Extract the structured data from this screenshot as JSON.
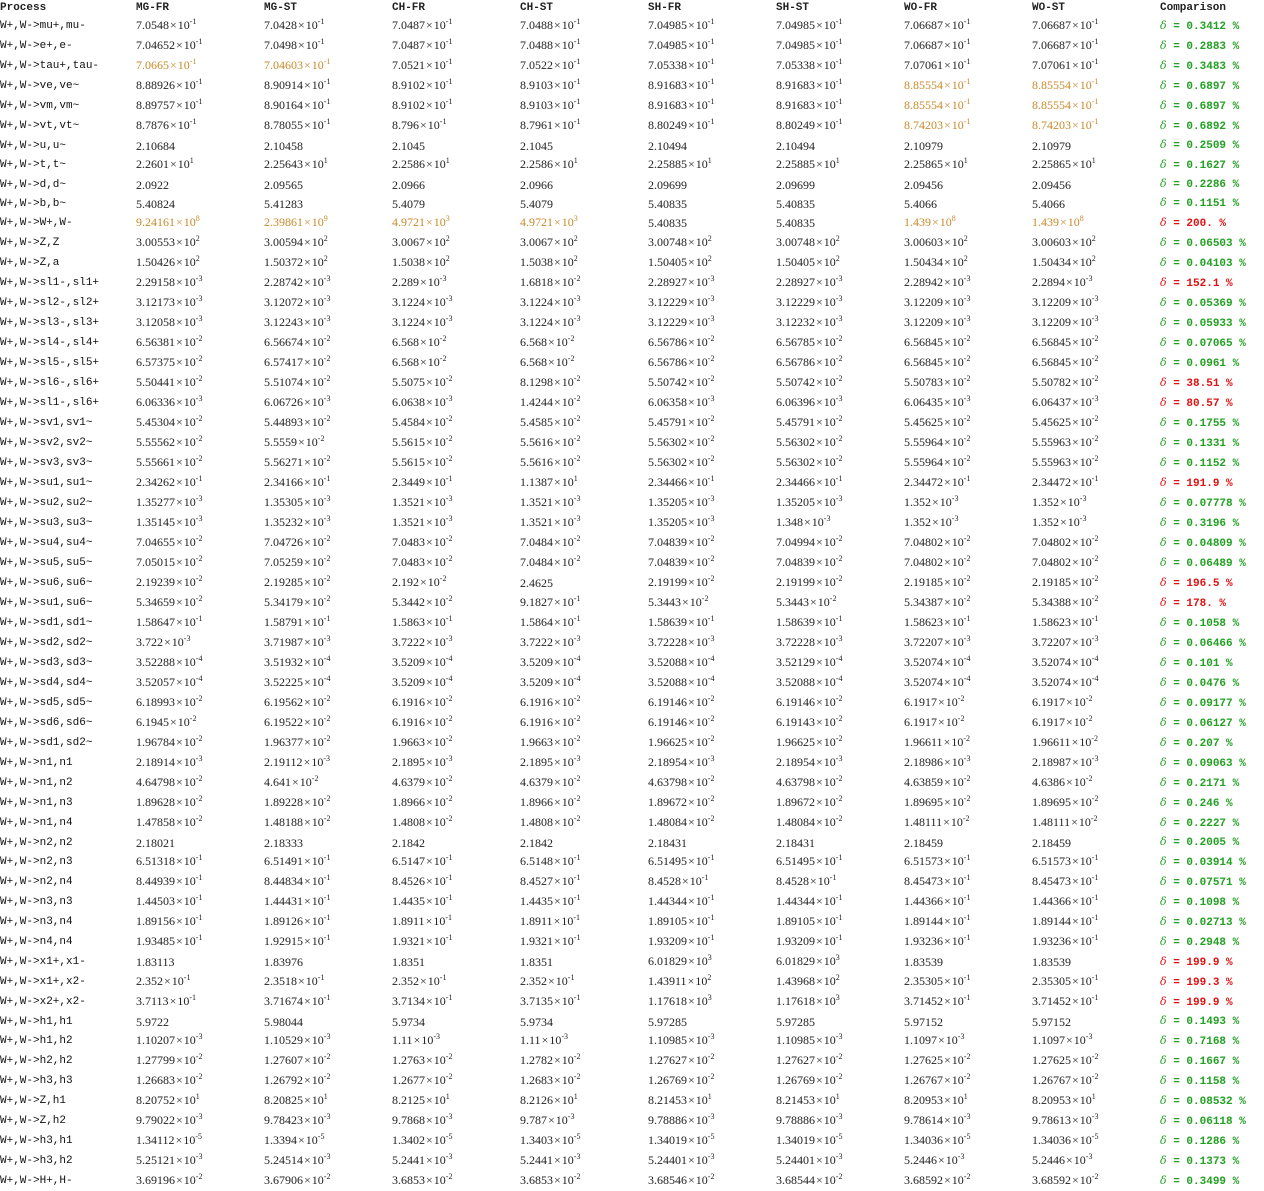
{
  "columns": [
    "Process",
    "MG-FR",
    "MG-ST",
    "CH-FR",
    "CH-ST",
    "SH-FR",
    "SH-ST",
    "WO-FR",
    "WO-ST",
    "Comparison"
  ],
  "colors": {
    "highlight": "#c88a2a",
    "good": "#22a022",
    "bad": "#dd1111"
  },
  "rows": [
    {
      "p": "W+,W->mu+,mu-",
      "v": [
        "7.0548|-1",
        "7.0428|-1",
        "7.0487|-1",
        "7.0488|-1",
        "7.04985|-1",
        "7.04985|-1",
        "7.06687|-1",
        "7.06687|-1"
      ],
      "hl": [],
      "c": "δ = 0.3412 %",
      "s": "good"
    },
    {
      "p": "W+,W->e+,e-",
      "v": [
        "7.04652|-1",
        "7.0498|-1",
        "7.0487|-1",
        "7.0488|-1",
        "7.04985|-1",
        "7.04985|-1",
        "7.06687|-1",
        "7.06687|-1"
      ],
      "hl": [],
      "c": "δ = 0.2883 %",
      "s": "good"
    },
    {
      "p": "W+,W->tau+,tau-",
      "v": [
        "7.0665|-1",
        "7.04603|-1",
        "7.0521|-1",
        "7.0522|-1",
        "7.05338|-1",
        "7.05338|-1",
        "7.07061|-1",
        "7.07061|-1"
      ],
      "hl": [
        0,
        1
      ],
      "c": "δ = 0.3483 %",
      "s": "good"
    },
    {
      "p": "W+,W->ve,ve~",
      "v": [
        "8.88926|-1",
        "8.90914|-1",
        "8.9102|-1",
        "8.9103|-1",
        "8.91683|-1",
        "8.91683|-1",
        "8.85554|-1",
        "8.85554|-1"
      ],
      "hl": [
        6,
        7
      ],
      "c": "δ = 0.6897 %",
      "s": "good"
    },
    {
      "p": "W+,W->vm,vm~",
      "v": [
        "8.89757|-1",
        "8.90164|-1",
        "8.9102|-1",
        "8.9103|-1",
        "8.91683|-1",
        "8.91683|-1",
        "8.85554|-1",
        "8.85554|-1"
      ],
      "hl": [
        6,
        7
      ],
      "c": "δ = 0.6897 %",
      "s": "good"
    },
    {
      "p": "W+,W->vt,vt~",
      "v": [
        "8.7876|-1",
        "8.78055|-1",
        "8.796|-1",
        "8.7961|-1",
        "8.80249|-1",
        "8.80249|-1",
        "8.74203|-1",
        "8.74203|-1"
      ],
      "hl": [
        6,
        7
      ],
      "c": "δ = 0.6892 %",
      "s": "good"
    },
    {
      "p": "W+,W->u,u~",
      "v": [
        "2.10684",
        "2.10458",
        "2.1045",
        "2.1045",
        "2.10494",
        "2.10494",
        "2.10979",
        "2.10979"
      ],
      "hl": [],
      "c": "δ = 0.2509 %",
      "s": "good"
    },
    {
      "p": "W+,W->t,t~",
      "v": [
        "2.2601|1",
        "2.25643|1",
        "2.2586|1",
        "2.2586|1",
        "2.25885|1",
        "2.25885|1",
        "2.25865|1",
        "2.25865|1"
      ],
      "hl": [],
      "c": "δ = 0.1627 %",
      "s": "good"
    },
    {
      "p": "W+,W->d,d~",
      "v": [
        "2.0922",
        "2.09565",
        "2.0966",
        "2.0966",
        "2.09699",
        "2.09699",
        "2.09456",
        "2.09456"
      ],
      "hl": [],
      "c": "δ = 0.2286 %",
      "s": "good"
    },
    {
      "p": "W+,W->b,b~",
      "v": [
        "5.40824",
        "5.41283",
        "5.4079",
        "5.4079",
        "5.40835",
        "5.40835",
        "5.4066",
        "5.4066"
      ],
      "hl": [],
      "c": "δ = 0.1151 %",
      "s": "good"
    },
    {
      "p": "W+,W->W+,W-",
      "v": [
        "9.24161|8",
        "2.39861|9",
        "4.9721|3",
        "4.9721|3",
        "5.40835",
        "5.40835",
        "1.439|8",
        "1.439|8"
      ],
      "hl": [
        0,
        1,
        2,
        3,
        6,
        7
      ],
      "c": "δ = 200. %",
      "s": "bad"
    },
    {
      "p": "W+,W->Z,Z",
      "v": [
        "3.00553|2",
        "3.00594|2",
        "3.0067|2",
        "3.0067|2",
        "3.00748|2",
        "3.00748|2",
        "3.00603|2",
        "3.00603|2"
      ],
      "hl": [],
      "c": "δ = 0.06503 %",
      "s": "good"
    },
    {
      "p": "W+,W->Z,a",
      "v": [
        "1.50426|2",
        "1.50372|2",
        "1.5038|2",
        "1.5038|2",
        "1.50405|2",
        "1.50405|2",
        "1.50434|2",
        "1.50434|2"
      ],
      "hl": [],
      "c": "δ = 0.04103 %",
      "s": "good"
    },
    {
      "p": "W+,W->sl1-,sl1+",
      "v": [
        "2.29158|-3",
        "2.28742|-3",
        "2.289|-3",
        "1.6818|-2",
        "2.28927|-3",
        "2.28927|-3",
        "2.28942|-3",
        "2.2894|-3"
      ],
      "hl": [],
      "c": "δ = 152.1 %",
      "s": "bad"
    },
    {
      "p": "W+,W->sl2-,sl2+",
      "v": [
        "3.12173|-3",
        "3.12072|-3",
        "3.1224|-3",
        "3.1224|-3",
        "3.12229|-3",
        "3.12229|-3",
        "3.12209|-3",
        "3.12209|-3"
      ],
      "hl": [],
      "c": "δ = 0.05369 %",
      "s": "good"
    },
    {
      "p": "W+,W->sl3-,sl3+",
      "v": [
        "3.12058|-3",
        "3.12243|-3",
        "3.1224|-3",
        "3.1224|-3",
        "3.12229|-3",
        "3.12232|-3",
        "3.12209|-3",
        "3.12209|-3"
      ],
      "hl": [],
      "c": "δ = 0.05933 %",
      "s": "good"
    },
    {
      "p": "W+,W->sl4-,sl4+",
      "v": [
        "6.56381|-2",
        "6.56674|-2",
        "6.568|-2",
        "6.568|-2",
        "6.56786|-2",
        "6.56785|-2",
        "6.56845|-2",
        "6.56845|-2"
      ],
      "hl": [],
      "c": "δ = 0.07065 %",
      "s": "good"
    },
    {
      "p": "W+,W->sl5-,sl5+",
      "v": [
        "6.57375|-2",
        "6.57417|-2",
        "6.568|-2",
        "6.568|-2",
        "6.56786|-2",
        "6.56786|-2",
        "6.56845|-2",
        "6.56845|-2"
      ],
      "hl": [],
      "c": "δ = 0.0961 %",
      "s": "good"
    },
    {
      "p": "W+,W->sl6-,sl6+",
      "v": [
        "5.50441|-2",
        "5.51074|-2",
        "5.5075|-2",
        "8.1298|-2",
        "5.50742|-2",
        "5.50742|-2",
        "5.50783|-2",
        "5.50782|-2"
      ],
      "hl": [],
      "c": "δ = 38.51 %",
      "s": "bad"
    },
    {
      "p": "W+,W->sl1-,sl6+",
      "v": [
        "6.06336|-3",
        "6.06726|-3",
        "6.0638|-3",
        "1.4244|-2",
        "6.06358|-3",
        "6.06396|-3",
        "6.06435|-3",
        "6.06437|-3"
      ],
      "hl": [],
      "c": "δ = 80.57 %",
      "s": "bad"
    },
    {
      "p": "W+,W->sv1,sv1~",
      "v": [
        "5.45304|-2",
        "5.44893|-2",
        "5.4584|-2",
        "5.4585|-2",
        "5.45791|-2",
        "5.45791|-2",
        "5.45625|-2",
        "5.45625|-2"
      ],
      "hl": [],
      "c": "δ = 0.1755 %",
      "s": "good"
    },
    {
      "p": "W+,W->sv2,sv2~",
      "v": [
        "5.55562|-2",
        "5.5559|-2",
        "5.5615|-2",
        "5.5616|-2",
        "5.56302|-2",
        "5.56302|-2",
        "5.55964|-2",
        "5.55963|-2"
      ],
      "hl": [],
      "c": "δ = 0.1331 %",
      "s": "good"
    },
    {
      "p": "W+,W->sv3,sv3~",
      "v": [
        "5.55661|-2",
        "5.56271|-2",
        "5.5615|-2",
        "5.5616|-2",
        "5.56302|-2",
        "5.56302|-2",
        "5.55964|-2",
        "5.55963|-2"
      ],
      "hl": [],
      "c": "δ = 0.1152 %",
      "s": "good"
    },
    {
      "p": "W+,W->su1,su1~",
      "v": [
        "2.34262|-1",
        "2.34166|-1",
        "2.3449|-1",
        "1.1387|1",
        "2.34466|-1",
        "2.34466|-1",
        "2.34472|-1",
        "2.34472|-1"
      ],
      "hl": [],
      "c": "δ = 191.9 %",
      "s": "bad"
    },
    {
      "p": "W+,W->su2,su2~",
      "v": [
        "1.35277|-3",
        "1.35305|-3",
        "1.3521|-3",
        "1.3521|-3",
        "1.35205|-3",
        "1.35205|-3",
        "1.352|-3",
        "1.352|-3"
      ],
      "hl": [],
      "c": "δ = 0.07778 %",
      "s": "good"
    },
    {
      "p": "W+,W->su3,su3~",
      "v": [
        "1.35145|-3",
        "1.35232|-3",
        "1.3521|-3",
        "1.3521|-3",
        "1.35205|-3",
        "1.348|-3",
        "1.352|-3",
        "1.352|-3"
      ],
      "hl": [],
      "c": "δ = 0.3196 %",
      "s": "good"
    },
    {
      "p": "W+,W->su4,su4~",
      "v": [
        "7.04655|-2",
        "7.04726|-2",
        "7.0483|-2",
        "7.0484|-2",
        "7.04839|-2",
        "7.04994|-2",
        "7.04802|-2",
        "7.04802|-2"
      ],
      "hl": [],
      "c": "δ = 0.04809 %",
      "s": "good"
    },
    {
      "p": "W+,W->su5,su5~",
      "v": [
        "7.05015|-2",
        "7.05259|-2",
        "7.0483|-2",
        "7.0484|-2",
        "7.04839|-2",
        "7.04839|-2",
        "7.04802|-2",
        "7.04802|-2"
      ],
      "hl": [],
      "c": "δ = 0.06489 %",
      "s": "good"
    },
    {
      "p": "W+,W->su6,su6~",
      "v": [
        "2.19239|-2",
        "2.19285|-2",
        "2.192|-2",
        "2.4625",
        "2.19199|-2",
        "2.19199|-2",
        "2.19185|-2",
        "2.19185|-2"
      ],
      "hl": [],
      "c": "δ = 196.5 %",
      "s": "bad"
    },
    {
      "p": "W+,W->su1,su6~",
      "v": [
        "5.34659|-2",
        "5.34179|-2",
        "5.3442|-2",
        "9.1827|-1",
        "5.3443|-2",
        "5.3443|-2",
        "5.34387|-2",
        "5.34388|-2"
      ],
      "hl": [],
      "c": "δ = 178. %",
      "s": "bad"
    },
    {
      "p": "W+,W->sd1,sd1~",
      "v": [
        "1.58647|-1",
        "1.58791|-1",
        "1.5863|-1",
        "1.5864|-1",
        "1.58639|-1",
        "1.58639|-1",
        "1.58623|-1",
        "1.58623|-1"
      ],
      "hl": [],
      "c": "δ = 0.1058 %",
      "s": "good"
    },
    {
      "p": "W+,W->sd2,sd2~",
      "v": [
        "3.722|-3",
        "3.71987|-3",
        "3.7222|-3",
        "3.7222|-3",
        "3.72228|-3",
        "3.72228|-3",
        "3.72207|-3",
        "3.72207|-3"
      ],
      "hl": [],
      "c": "δ = 0.06466 %",
      "s": "good"
    },
    {
      "p": "W+,W->sd3,sd3~",
      "v": [
        "3.52288|-4",
        "3.51932|-4",
        "3.5209|-4",
        "3.5209|-4",
        "3.52088|-4",
        "3.52129|-4",
        "3.52074|-4",
        "3.52074|-4"
      ],
      "hl": [],
      "c": "δ = 0.101 %",
      "s": "good"
    },
    {
      "p": "W+,W->sd4,sd4~",
      "v": [
        "3.52057|-4",
        "3.52225|-4",
        "3.5209|-4",
        "3.5209|-4",
        "3.52088|-4",
        "3.52088|-4",
        "3.52074|-4",
        "3.52074|-4"
      ],
      "hl": [],
      "c": "δ = 0.0476 %",
      "s": "good"
    },
    {
      "p": "W+,W->sd5,sd5~",
      "v": [
        "6.18993|-2",
        "6.19562|-2",
        "6.1916|-2",
        "6.1916|-2",
        "6.19146|-2",
        "6.19146|-2",
        "6.1917|-2",
        "6.1917|-2"
      ],
      "hl": [],
      "c": "δ = 0.09177 %",
      "s": "good"
    },
    {
      "p": "W+,W->sd6,sd6~",
      "v": [
        "6.1945|-2",
        "6.19522|-2",
        "6.1916|-2",
        "6.1916|-2",
        "6.19146|-2",
        "6.19143|-2",
        "6.1917|-2",
        "6.1917|-2"
      ],
      "hl": [],
      "c": "δ = 0.06127 %",
      "s": "good"
    },
    {
      "p": "W+,W->sd1,sd2~",
      "v": [
        "1.96784|-2",
        "1.96377|-2",
        "1.9663|-2",
        "1.9663|-2",
        "1.96625|-2",
        "1.96625|-2",
        "1.96611|-2",
        "1.96611|-2"
      ],
      "hl": [],
      "c": "δ = 0.207 %",
      "s": "good"
    },
    {
      "p": "W+,W->n1,n1",
      "v": [
        "2.18914|-3",
        "2.19112|-3",
        "2.1895|-3",
        "2.1895|-3",
        "2.18954|-3",
        "2.18954|-3",
        "2.18986|-3",
        "2.18987|-3"
      ],
      "hl": [],
      "c": "δ = 0.09063 %",
      "s": "good"
    },
    {
      "p": "W+,W->n1,n2",
      "v": [
        "4.64798|-2",
        "4.641|-2",
        "4.6379|-2",
        "4.6379|-2",
        "4.63798|-2",
        "4.63798|-2",
        "4.63859|-2",
        "4.6386|-2"
      ],
      "hl": [],
      "c": "δ = 0.2171 %",
      "s": "good"
    },
    {
      "p": "W+,W->n1,n3",
      "v": [
        "1.89628|-2",
        "1.89228|-2",
        "1.8966|-2",
        "1.8966|-2",
        "1.89672|-2",
        "1.89672|-2",
        "1.89695|-2",
        "1.89695|-2"
      ],
      "hl": [],
      "c": "δ = 0.246 %",
      "s": "good"
    },
    {
      "p": "W+,W->n1,n4",
      "v": [
        "1.47858|-2",
        "1.48188|-2",
        "1.4808|-2",
        "1.4808|-2",
        "1.48084|-2",
        "1.48084|-2",
        "1.48111|-2",
        "1.48111|-2"
      ],
      "hl": [],
      "c": "δ = 0.2227 %",
      "s": "good"
    },
    {
      "p": "W+,W->n2,n2",
      "v": [
        "2.18021",
        "2.18333",
        "2.1842",
        "2.1842",
        "2.18431",
        "2.18431",
        "2.18459",
        "2.18459"
      ],
      "hl": [],
      "c": "δ = 0.2005 %",
      "s": "good"
    },
    {
      "p": "W+,W->n2,n3",
      "v": [
        "6.51318|-1",
        "6.51491|-1",
        "6.5147|-1",
        "6.5148|-1",
        "6.51495|-1",
        "6.51495|-1",
        "6.51573|-1",
        "6.51573|-1"
      ],
      "hl": [],
      "c": "δ = 0.03914 %",
      "s": "good"
    },
    {
      "p": "W+,W->n2,n4",
      "v": [
        "8.44939|-1",
        "8.44834|-1",
        "8.4526|-1",
        "8.4527|-1",
        "8.4528|-1",
        "8.4528|-1",
        "8.45473|-1",
        "8.45473|-1"
      ],
      "hl": [],
      "c": "δ = 0.07571 %",
      "s": "good"
    },
    {
      "p": "W+,W->n3,n3",
      "v": [
        "1.44503|-1",
        "1.44431|-1",
        "1.4435|-1",
        "1.4435|-1",
        "1.44344|-1",
        "1.44344|-1",
        "1.44366|-1",
        "1.44366|-1"
      ],
      "hl": [],
      "c": "δ = 0.1098 %",
      "s": "good"
    },
    {
      "p": "W+,W->n3,n4",
      "v": [
        "1.89156|-1",
        "1.89126|-1",
        "1.8911|-1",
        "1.8911|-1",
        "1.89105|-1",
        "1.89105|-1",
        "1.89144|-1",
        "1.89144|-1"
      ],
      "hl": [],
      "c": "δ = 0.02713 %",
      "s": "good"
    },
    {
      "p": "W+,W->n4,n4",
      "v": [
        "1.93485|-1",
        "1.92915|-1",
        "1.9321|-1",
        "1.9321|-1",
        "1.93209|-1",
        "1.93209|-1",
        "1.93236|-1",
        "1.93236|-1"
      ],
      "hl": [],
      "c": "δ = 0.2948 %",
      "s": "good"
    },
    {
      "p": "W+,W->x1+,x1-",
      "v": [
        "1.83113",
        "1.83976",
        "1.8351",
        "1.8351",
        "6.01829|3",
        "6.01829|3",
        "1.83539",
        "1.83539"
      ],
      "hl": [],
      "c": "δ = 199.9 %",
      "s": "bad"
    },
    {
      "p": "W+,W->x1+,x2-",
      "v": [
        "2.352|-1",
        "2.3518|-1",
        "2.352|-1",
        "2.352|-1",
        "1.43911|2",
        "1.43968|2",
        "2.35305|-1",
        "2.35305|-1"
      ],
      "hl": [],
      "c": "δ = 199.3 %",
      "s": "bad"
    },
    {
      "p": "W+,W->x2+,x2-",
      "v": [
        "3.7113|-1",
        "3.71674|-1",
        "3.7134|-1",
        "3.7135|-1",
        "1.17618|3",
        "1.17618|3",
        "3.71452|-1",
        "3.71452|-1"
      ],
      "hl": [],
      "c": "δ = 199.9 %",
      "s": "bad"
    },
    {
      "p": "W+,W->h1,h1",
      "v": [
        "5.9722",
        "5.98044",
        "5.9734",
        "5.9734",
        "5.97285",
        "5.97285",
        "5.97152",
        "5.97152"
      ],
      "hl": [],
      "c": "δ = 0.1493 %",
      "s": "good"
    },
    {
      "p": "W+,W->h1,h2",
      "v": [
        "1.10207|-3",
        "1.10529|-3",
        "1.11|-3",
        "1.11|-3",
        "1.10985|-3",
        "1.10985|-3",
        "1.1097|-3",
        "1.1097|-3"
      ],
      "hl": [],
      "c": "δ = 0.7168 %",
      "s": "good"
    },
    {
      "p": "W+,W->h2,h2",
      "v": [
        "1.27799|-2",
        "1.27607|-2",
        "1.2763|-2",
        "1.2782|-2",
        "1.27627|-2",
        "1.27627|-2",
        "1.27625|-2",
        "1.27625|-2"
      ],
      "hl": [],
      "c": "δ = 0.1667 %",
      "s": "good"
    },
    {
      "p": "W+,W->h3,h3",
      "v": [
        "1.26683|-2",
        "1.26792|-2",
        "1.2677|-2",
        "1.2683|-2",
        "1.26769|-2",
        "1.26769|-2",
        "1.26767|-2",
        "1.26767|-2"
      ],
      "hl": [],
      "c": "δ = 0.1158 %",
      "s": "good"
    },
    {
      "p": "W+,W->Z,h1",
      "v": [
        "8.20752|1",
        "8.20825|1",
        "8.2125|1",
        "8.2126|1",
        "8.21453|1",
        "8.21453|1",
        "8.20953|1",
        "8.20953|1"
      ],
      "hl": [],
      "c": "δ = 0.08532 %",
      "s": "good"
    },
    {
      "p": "W+,W->Z,h2",
      "v": [
        "9.79022|-3",
        "9.78423|-3",
        "9.7868|-3",
        "9.787|-3",
        "9.78886|-3",
        "9.78886|-3",
        "9.78614|-3",
        "9.78613|-3"
      ],
      "hl": [],
      "c": "δ = 0.06118 %",
      "s": "good"
    },
    {
      "p": "W+,W->h3,h1",
      "v": [
        "1.34112|-5",
        "1.3394|-5",
        "1.3402|-5",
        "1.3403|-5",
        "1.34019|-5",
        "1.34019|-5",
        "1.34036|-5",
        "1.34036|-5"
      ],
      "hl": [],
      "c": "δ = 0.1286 %",
      "s": "good"
    },
    {
      "p": "W+,W->h3,h2",
      "v": [
        "5.25121|-3",
        "5.24514|-3",
        "5.2441|-3",
        "5.2441|-3",
        "5.24401|-3",
        "5.24401|-3",
        "5.2446|-3",
        "5.2446|-3"
      ],
      "hl": [],
      "c": "δ = 0.1373 %",
      "s": "good"
    },
    {
      "p": "W+,W->H+,H-",
      "v": [
        "3.69196|-2",
        "3.67906|-2",
        "3.6853|-2",
        "3.6853|-2",
        "3.68546|-2",
        "3.68544|-2",
        "3.68592|-2",
        "3.68592|-2"
      ],
      "hl": [],
      "c": "δ = 0.3499 %",
      "s": "good"
    }
  ]
}
